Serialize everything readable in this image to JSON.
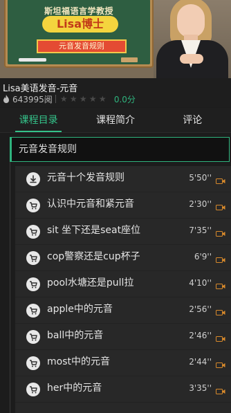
{
  "banner": {
    "caption": "斯坦福语言学教授",
    "title": "Lisa博士",
    "tag": "元音发音规则"
  },
  "course": {
    "title": "Lisa美语发音-元音",
    "views": "643995阅",
    "rating_stars": 0,
    "score": "0.0分"
  },
  "tabs": [
    {
      "label": "课程目录",
      "active": true
    },
    {
      "label": "课程简介",
      "active": false
    },
    {
      "label": "评论",
      "active": false
    }
  ],
  "chapter": {
    "title": "元音发音规则"
  },
  "lessons": [
    {
      "title": "元音十个发音规则",
      "duration": "5'50''",
      "icon": "download-icon"
    },
    {
      "title": "认识中元音和紧元音",
      "duration": "2'30''",
      "icon": "cart-icon"
    },
    {
      "title": "sit 坐下还是seat座位",
      "duration": "7'35''",
      "icon": "cart-icon"
    },
    {
      "title": "cop警察还是cup杯子",
      "duration": "6'9''",
      "icon": "cart-icon"
    },
    {
      "title": "pool水塘还是pull拉",
      "duration": "4'10''",
      "icon": "cart-icon"
    },
    {
      "title": "apple中的元音",
      "duration": "2'56''",
      "icon": "cart-icon"
    },
    {
      "title": "ball中的元音",
      "duration": "2'46''",
      "icon": "cart-icon"
    },
    {
      "title": "most中的元音",
      "duration": "2'44''",
      "icon": "cart-icon"
    },
    {
      "title": "her中的元音",
      "duration": "3'35''",
      "icon": "cart-icon"
    }
  ],
  "colors": {
    "accent": "#34c38a",
    "camera": "#d98a2b"
  }
}
